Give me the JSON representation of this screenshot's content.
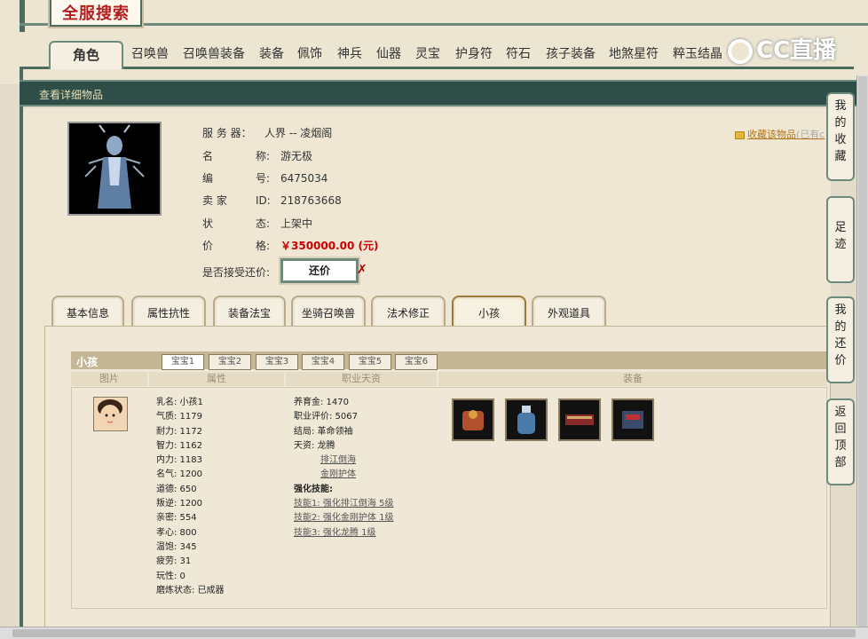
{
  "logo": "全服搜索",
  "tabs": [
    "角色",
    "召唤兽",
    "召唤兽装备",
    "装备",
    "佩饰",
    "神兵",
    "仙器",
    "灵宝",
    "护身符",
    "符石",
    "孩子装备",
    "地煞星符",
    "粹玉结晶"
  ],
  "watermark": "CC直播",
  "header": "查看详细物品",
  "item": {
    "server_label": "服 务 器：",
    "server": "人界 -- 凌烟阁",
    "name_k1": "名",
    "name_k2": "称:",
    "name": "游无极",
    "id_k1": "编",
    "id_k2": "号:",
    "id": "6475034",
    "seller_k": "卖 家",
    "seller_k2": "ID:",
    "seller": "218763668",
    "status_k1": "状",
    "status_k2": "态:",
    "status": "上架中",
    "price_k1": "价",
    "price_k2": "格:",
    "price": "￥350000.00 (元)",
    "bargain_label": "是否接受还价:",
    "bargain_btn": "还价",
    "bargain_x": "✗"
  },
  "favorite": {
    "link": "收藏该物品",
    "note": "(已有c"
  },
  "subtabs": [
    "基本信息",
    "属性抗性",
    "装备法宝",
    "坐骑召唤兽",
    "法术修正",
    "小孩",
    "外观道具"
  ],
  "kid": {
    "title": "小孩",
    "babies": [
      "宝宝1",
      "宝宝2",
      "宝宝3",
      "宝宝4",
      "宝宝5",
      "宝宝6"
    ],
    "cols": [
      "图片",
      "属性",
      "职业天资",
      "装备"
    ],
    "attrs": [
      "乳名: 小孩1",
      "气质: 1179",
      "耐力: 1172",
      "智力: 1162",
      "内力: 1183",
      "名气: 1200",
      "道德: 650",
      "叛逆: 1200",
      "亲密: 554",
      "孝心: 800",
      "温饱: 345",
      "疲劳: 31",
      "玩性: 0",
      "磨炼状态: 已成器"
    ],
    "talent": [
      "养育金: 1470",
      "职业评价: 5067",
      "结局: 革命领袖",
      "天资: 龙腾",
      "排江倒海",
      "金刚护体",
      "强化技能:",
      "技能1: 强化排江倒海 5级",
      "技能2: 强化金刚护体 1级",
      "技能3: 强化龙腾 1级"
    ]
  },
  "side": [
    "我的收藏",
    "足迹",
    "我的还价",
    "返回顶部"
  ]
}
